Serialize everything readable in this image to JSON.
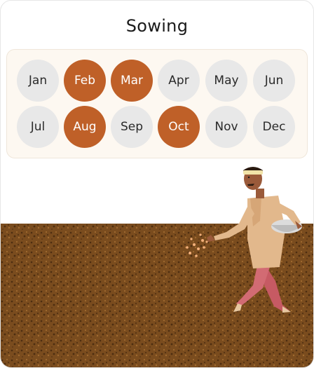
{
  "title": "Sowing",
  "months": [
    {
      "label": "Jan",
      "active": false
    },
    {
      "label": "Feb",
      "active": true
    },
    {
      "label": "Mar",
      "active": true
    },
    {
      "label": "Apr",
      "active": false
    },
    {
      "label": "May",
      "active": false
    },
    {
      "label": "Jun",
      "active": false
    },
    {
      "label": "Jul",
      "active": false
    },
    {
      "label": "Aug",
      "active": true
    },
    {
      "label": "Sep",
      "active": false
    },
    {
      "label": "Oct",
      "active": true
    },
    {
      "label": "Nov",
      "active": false
    },
    {
      "label": "Dec",
      "active": false
    }
  ],
  "colors": {
    "active": "#bf6028",
    "inactive": "#e8e8e8",
    "soil": "#7a4c1e",
    "panel_bg": "#fdf8f1"
  },
  "illustration": {
    "icon": "farmer-sowing-seeds-illustration"
  }
}
